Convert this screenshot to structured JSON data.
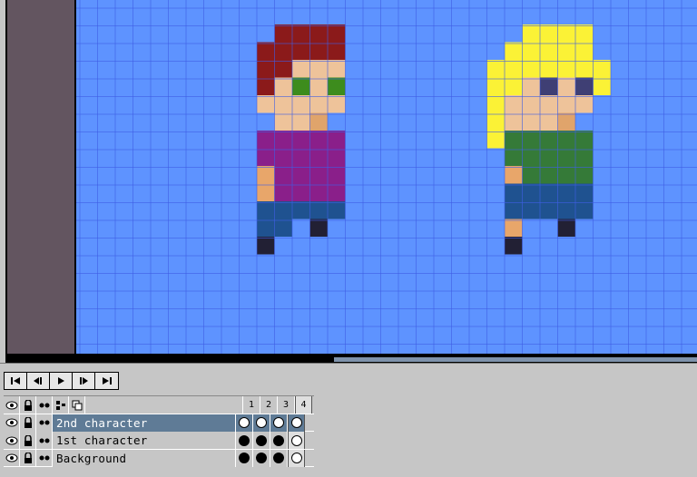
{
  "playback": {
    "buttons": [
      "first-frame",
      "previous-frame",
      "play",
      "next-frame",
      "last-frame"
    ]
  },
  "layers_header": {
    "icons": [
      "eye-icon",
      "lock-icon",
      "continuous-icon",
      "group-icon",
      "new-layer-icon"
    ],
    "frames": [
      "1",
      "2",
      "3",
      "4"
    ],
    "current_frame": 4
  },
  "layers": [
    {
      "name": "2nd character",
      "active": true,
      "cels": [
        "empty",
        "empty",
        "empty",
        "empty"
      ]
    },
    {
      "name": "1st character",
      "active": false,
      "cels": [
        "full",
        "full",
        "full",
        "empty"
      ]
    },
    {
      "name": "Background",
      "active": false,
      "cels": [
        "full",
        "full",
        "full",
        "empty"
      ]
    }
  ],
  "colors": {
    "canvas_bg": "#5e93ff",
    "grid": "#3f5ee6",
    "side_area": "#635560",
    "active_layer": "#5f7b96"
  }
}
